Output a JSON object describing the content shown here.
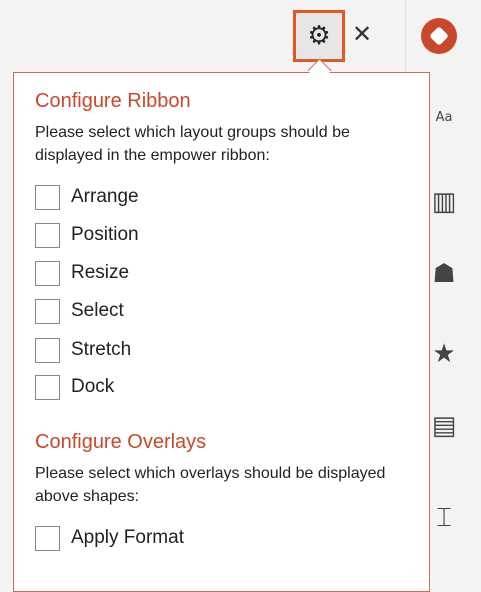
{
  "header": {
    "settings_icon": "gear-icon",
    "close_icon": "close-icon"
  },
  "rail": {
    "icons": [
      "app-logo",
      "font-icon",
      "books-icon",
      "people-icon",
      "star-icon",
      "card-icon",
      "text-frame-icon"
    ]
  },
  "panel": {
    "ribbon": {
      "title": "Configure Ribbon",
      "description": "Please select which layout groups should be displayed in the empower ribbon:",
      "options": [
        {
          "label": "Arrange",
          "checked": false
        },
        {
          "label": "Position",
          "checked": false
        },
        {
          "label": "Resize",
          "checked": false
        },
        {
          "label": "Select",
          "checked": false
        },
        {
          "label": "Stretch",
          "checked": false
        },
        {
          "label": "Dock",
          "checked": false
        }
      ]
    },
    "overlays": {
      "title": "Configure Overlays",
      "description": "Please select which overlays should be displayed above shapes:",
      "options": [
        {
          "label": "Apply Format",
          "checked": false
        }
      ]
    }
  },
  "colors": {
    "accent": "#c8482c",
    "highlight_border": "#e2581e"
  }
}
